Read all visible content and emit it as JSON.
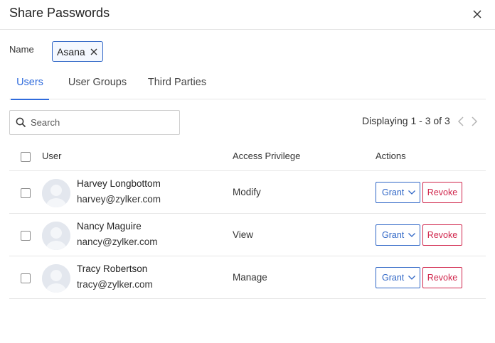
{
  "dialog": {
    "title": "Share Passwords",
    "close_icon": "close-icon"
  },
  "name_field": {
    "label": "Name",
    "tags": [
      "Asana"
    ],
    "remove_icon": "close-icon"
  },
  "tabs": [
    {
      "label": "Users",
      "active": true
    },
    {
      "label": "User Groups",
      "active": false
    },
    {
      "label": "Third Parties",
      "active": false
    }
  ],
  "search": {
    "placeholder": "Search",
    "value": "",
    "icon": "search-icon"
  },
  "pagination": {
    "text": "Displaying 1 - 3 of 3",
    "prev_icon": "chevron-left-icon",
    "next_icon": "chevron-right-icon"
  },
  "table": {
    "headers": {
      "user": "User",
      "privilege": "Access Privilege",
      "actions": "Actions"
    },
    "rows": [
      {
        "name": "Harvey Longbottom",
        "email": "harvey@zylker.com",
        "privilege": "Modify",
        "grant_label": "Grant",
        "revoke_label": "Revoke"
      },
      {
        "name": "Nancy Maguire",
        "email": "nancy@zylker.com",
        "privilege": "View",
        "grant_label": "Grant",
        "revoke_label": "Revoke"
      },
      {
        "name": "Tracy Robertson",
        "email": "tracy@zylker.com",
        "privilege": "Manage",
        "grant_label": "Grant",
        "revoke_label": "Revoke"
      }
    ]
  },
  "colors": {
    "accent": "#2f6bdc",
    "grant": "#2f66c6",
    "revoke": "#d0254b"
  }
}
